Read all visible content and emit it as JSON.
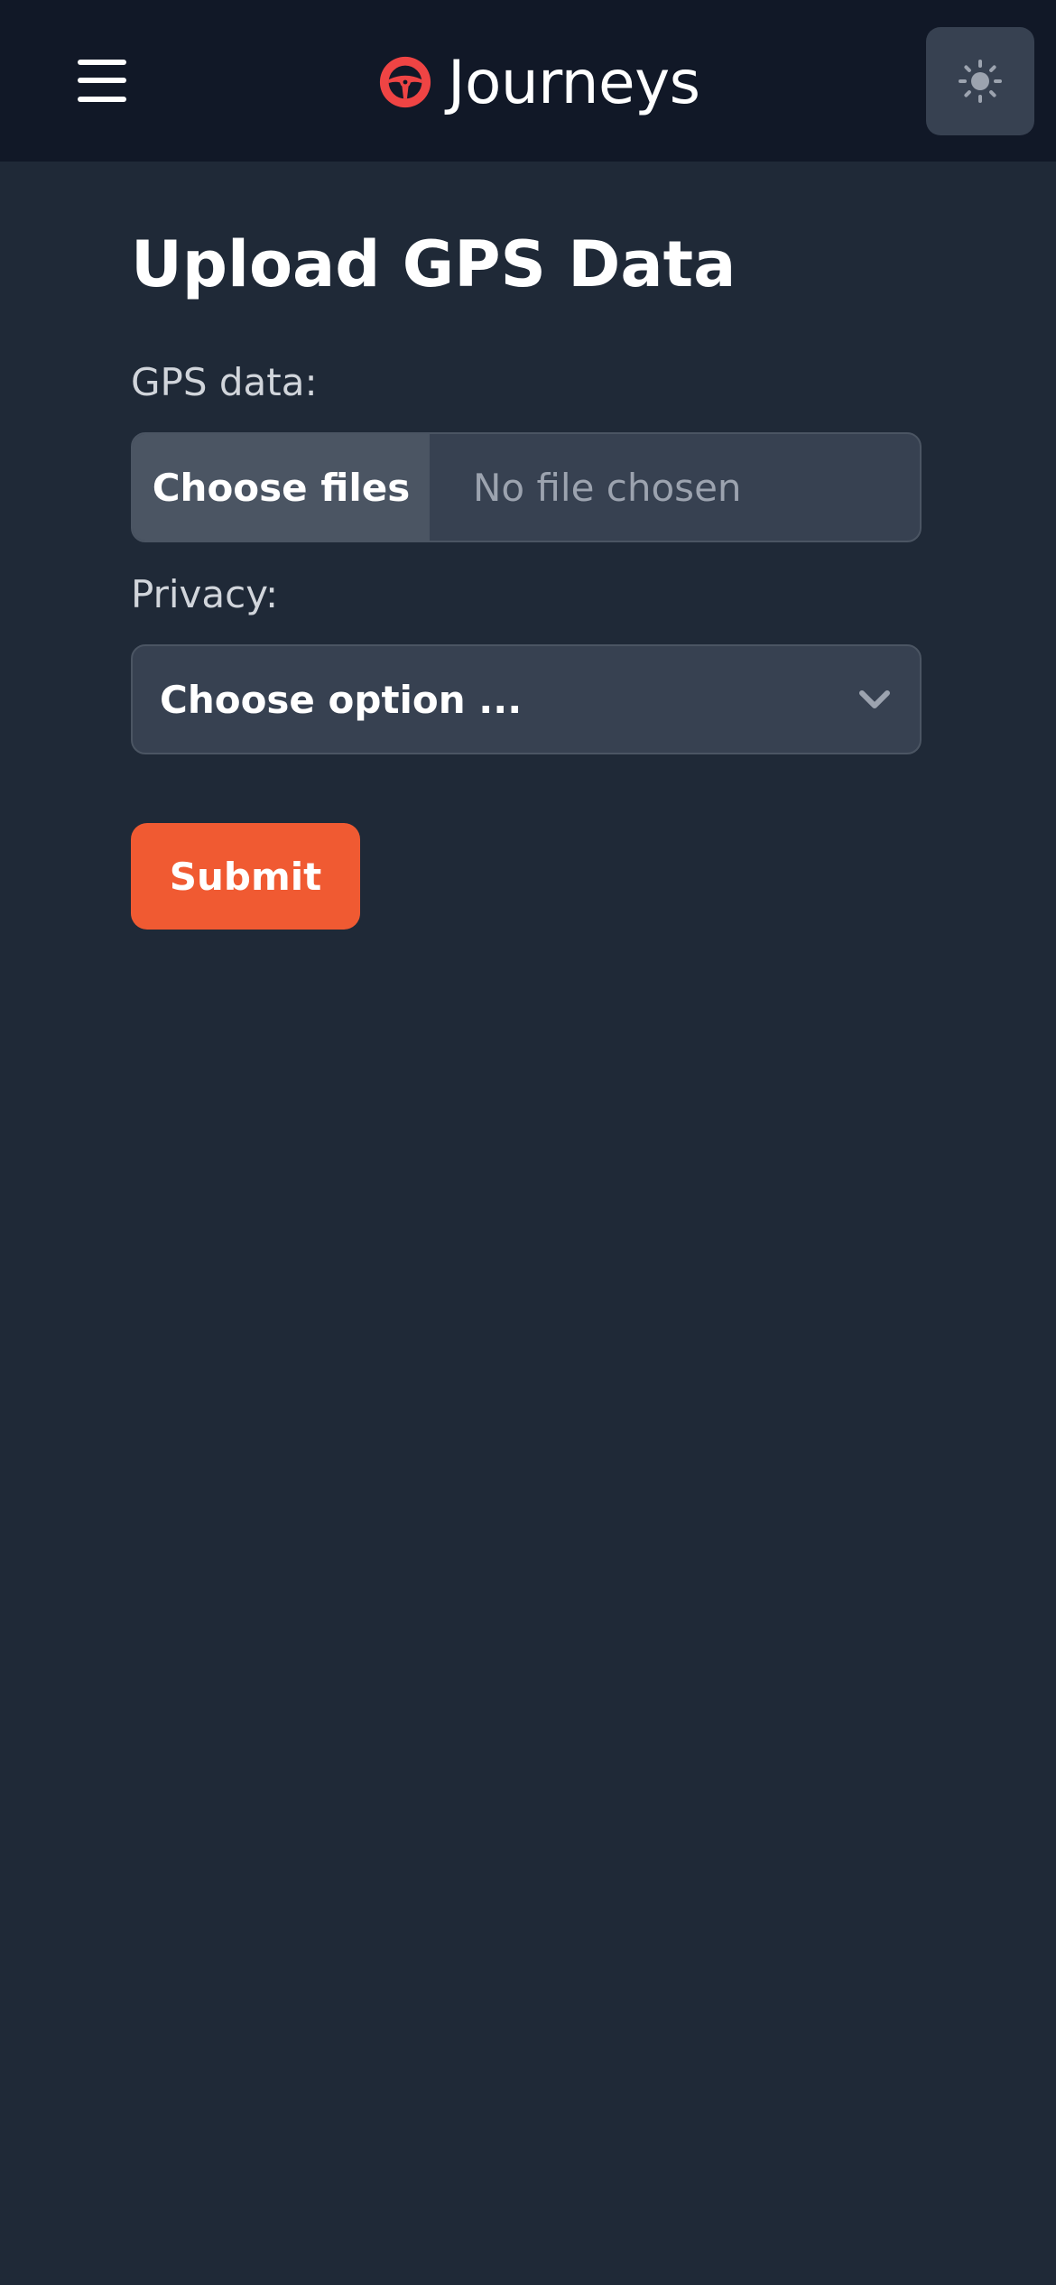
{
  "header": {
    "menu_icon": "hamburger-menu-icon",
    "brand_icon": "steering-wheel-icon",
    "brand_title": "Journeys",
    "theme_icon": "sun-icon"
  },
  "form": {
    "title": "Upload GPS Data",
    "gps_label": "GPS data:",
    "file_button_label": "Choose files",
    "file_status": "No file chosen",
    "privacy_label": "Privacy:",
    "privacy_selected": "Choose option ...",
    "submit_label": "Submit"
  },
  "colors": {
    "header_bg": "#111827",
    "page_bg": "#1f2937",
    "input_bg": "#374151",
    "file_button_bg": "#4b5563",
    "brand_accent": "#ef4444",
    "submit_bg": "#f05a32"
  }
}
